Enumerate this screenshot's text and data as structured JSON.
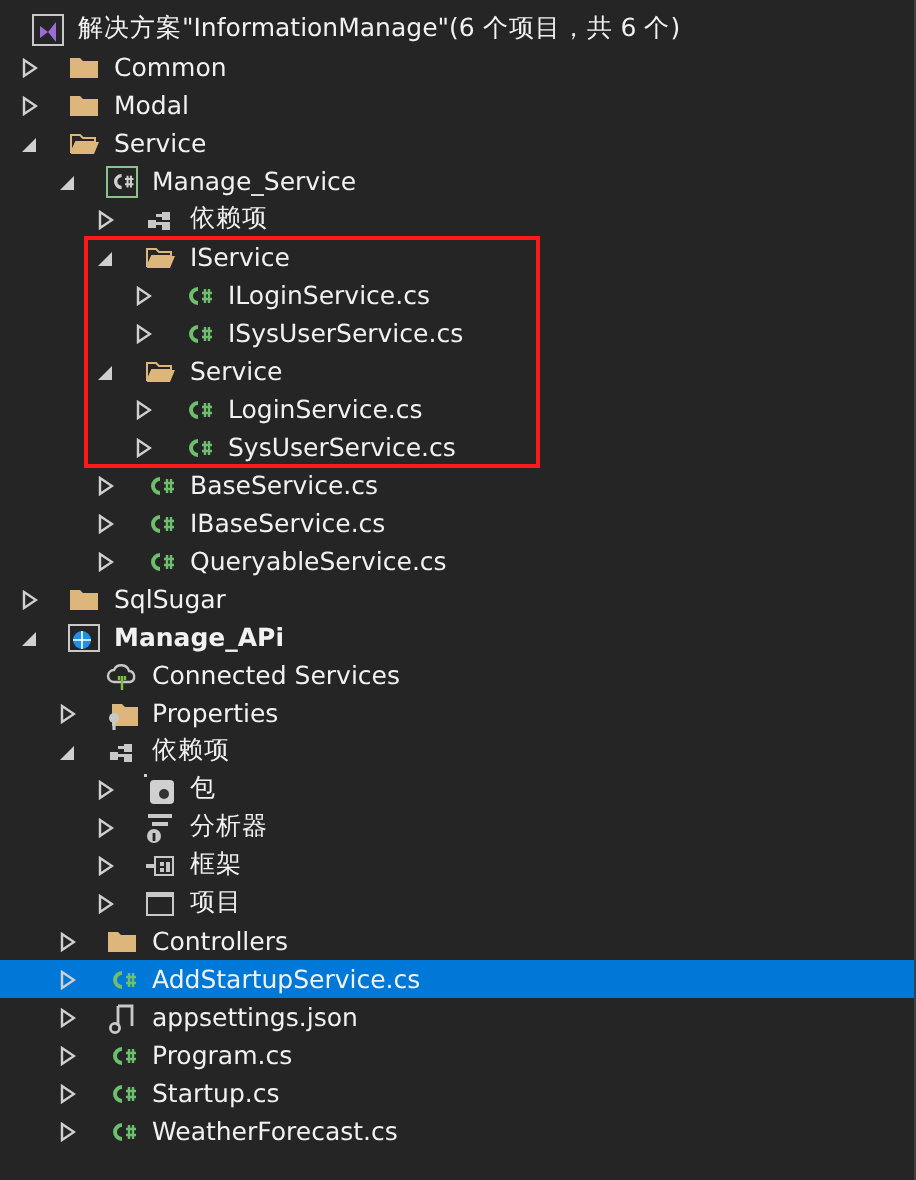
{
  "solution": {
    "label": "解决方案\"InformationManage\"(6 个项目，共 6 个)"
  },
  "tree": [
    {
      "label": "Common",
      "kind": "folder",
      "expanded": false,
      "selected": false
    },
    {
      "label": "Modal",
      "kind": "folder",
      "expanded": false,
      "selected": false
    },
    {
      "label": "Service",
      "kind": "folder",
      "expanded": true,
      "selected": false,
      "children": [
        {
          "label": "Manage_Service",
          "kind": "csharp-project",
          "expanded": true,
          "selected": false,
          "children": [
            {
              "label": "依赖项",
              "kind": "dependencies",
              "expanded": false,
              "selected": false
            },
            {
              "label": "IService",
              "kind": "folder",
              "expanded": true,
              "selected": false,
              "outlined": true,
              "children": [
                {
                  "label": "ILoginService.cs",
                  "kind": "csharp-file",
                  "expanded": false,
                  "selected": false
                },
                {
                  "label": "ISysUserService.cs",
                  "kind": "csharp-file",
                  "expanded": false,
                  "selected": false
                }
              ]
            },
            {
              "label": "Service",
              "kind": "folder",
              "expanded": true,
              "selected": false,
              "outlined": true,
              "children": [
                {
                  "label": "LoginService.cs",
                  "kind": "csharp-file",
                  "expanded": false,
                  "selected": false
                },
                {
                  "label": "SysUserService.cs",
                  "kind": "csharp-file",
                  "expanded": false,
                  "selected": false
                }
              ]
            },
            {
              "label": "BaseService.cs",
              "kind": "csharp-file",
              "expanded": false,
              "selected": false
            },
            {
              "label": "IBaseService.cs",
              "kind": "csharp-file",
              "expanded": false,
              "selected": false
            },
            {
              "label": "QueryableService.cs",
              "kind": "csharp-file",
              "expanded": false,
              "selected": false
            }
          ]
        }
      ]
    },
    {
      "label": "SqlSugar",
      "kind": "folder",
      "expanded": false,
      "selected": false
    },
    {
      "label": "Manage_APi",
      "kind": "web-project",
      "expanded": true,
      "selected": false,
      "bold": true,
      "children": [
        {
          "label": "Connected Services",
          "kind": "connected-services",
          "selected": false
        },
        {
          "label": "Properties",
          "kind": "properties-folder",
          "expanded": false,
          "selected": false
        },
        {
          "label": "依赖项",
          "kind": "dependencies",
          "expanded": true,
          "selected": false,
          "children": [
            {
              "label": "包",
              "kind": "package",
              "expanded": false,
              "selected": false
            },
            {
              "label": "分析器",
              "kind": "analyzer",
              "expanded": false,
              "selected": false
            },
            {
              "label": "框架",
              "kind": "framework",
              "expanded": false,
              "selected": false
            },
            {
              "label": "项目",
              "kind": "project-reference",
              "expanded": false,
              "selected": false
            }
          ]
        },
        {
          "label": "Controllers",
          "kind": "folder",
          "expanded": false,
          "selected": false
        },
        {
          "label": "AddStartupService.cs",
          "kind": "csharp-file",
          "expanded": false,
          "selected": true
        },
        {
          "label": "appsettings.json",
          "kind": "json-file",
          "expanded": false,
          "selected": false
        },
        {
          "label": "Program.cs",
          "kind": "csharp-file",
          "expanded": false,
          "selected": false
        },
        {
          "label": "Startup.cs",
          "kind": "csharp-file",
          "expanded": false,
          "selected": false
        },
        {
          "label": "WeatherForecast.cs",
          "kind": "csharp-file",
          "expanded": false,
          "selected": false
        }
      ]
    }
  ]
}
